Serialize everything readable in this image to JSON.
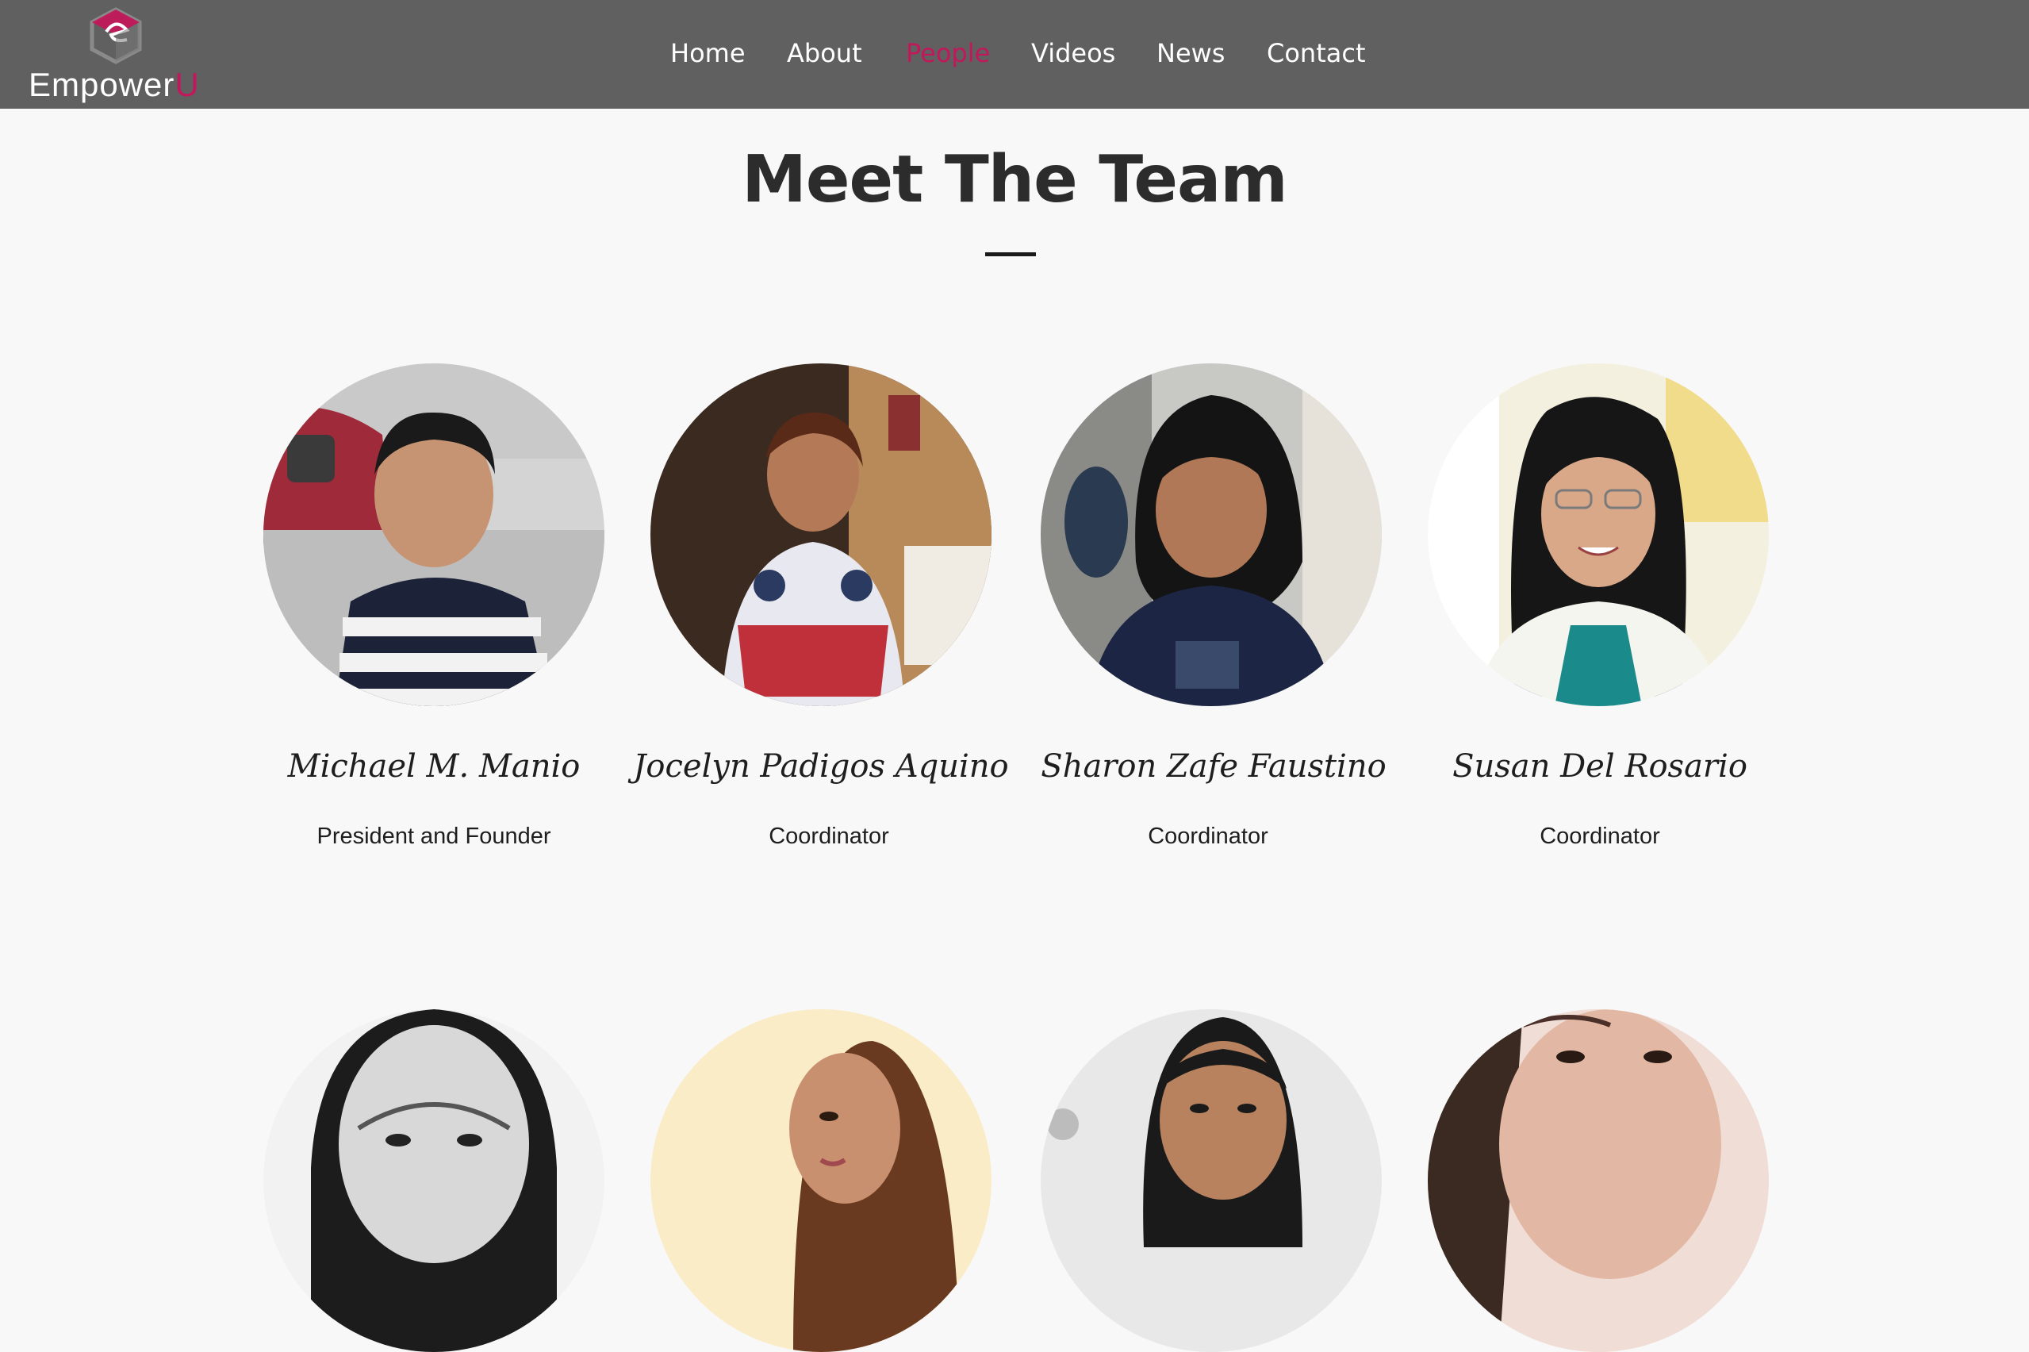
{
  "brand": {
    "name": "Empower",
    "accent_letter": "U",
    "accent_color": "#c2185b",
    "header_color": "#606060"
  },
  "nav": {
    "items": [
      {
        "label": "Home"
      },
      {
        "label": "About"
      },
      {
        "label": "People",
        "active": true
      },
      {
        "label": "Videos"
      },
      {
        "label": "News"
      },
      {
        "label": "Contact"
      }
    ]
  },
  "page": {
    "title": "Meet The Team"
  },
  "team": [
    {
      "name": "Michael M. Manio",
      "role": "President and Founder"
    },
    {
      "name": "Jocelyn Padigos Aquino",
      "role": "Coordinator"
    },
    {
      "name": "Sharon Zafe Faustino",
      "role": "Coordinator"
    },
    {
      "name": "Susan Del Rosario",
      "role": "Coordinator"
    }
  ]
}
